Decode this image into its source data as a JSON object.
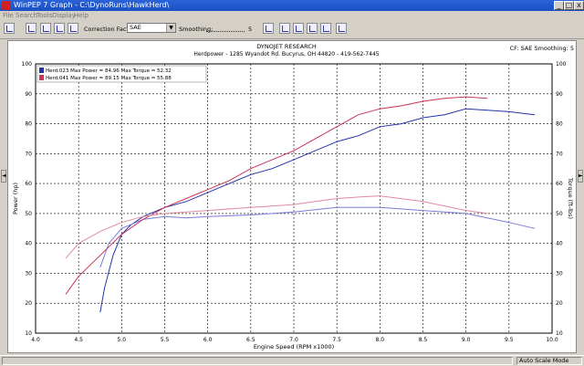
{
  "window": {
    "title": "WinPEP 7    Graph - C:\\DynoRuns\\HawkHerd\\"
  },
  "menu": [
    "File",
    "Search",
    "Tools",
    "Display",
    "Help"
  ],
  "toolbar": {
    "correction_label": "Correction Factor",
    "correction_value": "SAE",
    "smoothing_label": "Smoothing:",
    "smoothing_value": "5"
  },
  "header": {
    "company": "DYNOJET RESEARCH",
    "address": "Herdpower - 1285 Wyandot Rd. Bucyrus, OH  44820 - 419-562-7445",
    "cf_label": "CF: SAE  Smoothing: 5"
  },
  "status": {
    "mode": "Auto Scale Mode"
  },
  "colors": {
    "run1": "#2233aa",
    "run2": "#cc3355",
    "run1_torque": "#7a7ad6",
    "run2_torque": "#e08a9e"
  },
  "chart_data": {
    "type": "line",
    "xlabel": "Engine Speed (RPM x1000)",
    "ylabel": "Power (hp)",
    "y2label": "Torque (ft-lbs)",
    "xlim": [
      4.0,
      10.0
    ],
    "ylim": [
      10,
      100
    ],
    "y2lim": [
      10,
      100
    ],
    "x_ticks": [
      "4.0",
      "4.5",
      "5.0",
      "5.5",
      "6.0",
      "6.5",
      "7.0",
      "7.5",
      "8.0",
      "8.5",
      "9.0",
      "9.5",
      "10.0"
    ],
    "y_ticks": [
      "10",
      "20",
      "30",
      "40",
      "50",
      "60",
      "70",
      "80",
      "90",
      "100"
    ],
    "grid": true,
    "legend_position": "top-left",
    "legend": [
      "Herd.023 Max Power = 84.96 Max Torque = 52.32",
      "Herd.041 Max Power = 89.15 Max Torque = 55.88"
    ],
    "series": [
      {
        "name": "Herd.023",
        "kind": "power",
        "x": [
          4.75,
          4.8,
          4.9,
          5.0,
          5.1,
          5.25,
          5.5,
          5.75,
          6.0,
          6.25,
          6.5,
          6.75,
          7.0,
          7.25,
          7.5,
          7.75,
          8.0,
          8.25,
          8.5,
          8.75,
          9.0,
          9.25,
          9.5,
          9.8
        ],
        "y": [
          17,
          25,
          36,
          43,
          46,
          49,
          52,
          54,
          57,
          60,
          63,
          65,
          68,
          71,
          74,
          76,
          79,
          80,
          82,
          83,
          85,
          84.5,
          84,
          83
        ]
      },
      {
        "name": "Herd.023",
        "kind": "torque",
        "x": [
          4.75,
          4.85,
          5.0,
          5.25,
          5.5,
          5.75,
          6.0,
          6.5,
          7.0,
          7.5,
          8.0,
          8.5,
          9.0,
          9.5,
          9.8
        ],
        "y": [
          32,
          40,
          45,
          48,
          49,
          48.5,
          49,
          49.5,
          50.5,
          52,
          52,
          51,
          50,
          47,
          45
        ]
      },
      {
        "name": "Herd.041",
        "kind": "power",
        "x": [
          4.35,
          4.5,
          4.75,
          5.0,
          5.25,
          5.5,
          5.75,
          6.0,
          6.25,
          6.5,
          6.75,
          7.0,
          7.25,
          7.5,
          7.75,
          8.0,
          8.25,
          8.5,
          8.75,
          9.0,
          9.25
        ],
        "y": [
          23,
          29,
          36,
          43,
          48,
          52,
          55,
          58,
          61,
          65,
          68,
          71,
          75,
          79,
          83,
          85,
          86,
          87.5,
          88.5,
          89,
          88.5
        ]
      },
      {
        "name": "Herd.041",
        "kind": "torque",
        "x": [
          4.35,
          4.5,
          4.75,
          5.0,
          5.25,
          5.5,
          6.0,
          6.5,
          7.0,
          7.25,
          7.5,
          7.75,
          8.0,
          8.5,
          9.0,
          9.25
        ],
        "y": [
          35,
          40,
          44,
          47,
          49,
          50,
          51,
          52,
          53,
          54,
          55,
          55.5,
          55.9,
          54,
          51,
          50
        ]
      }
    ]
  }
}
